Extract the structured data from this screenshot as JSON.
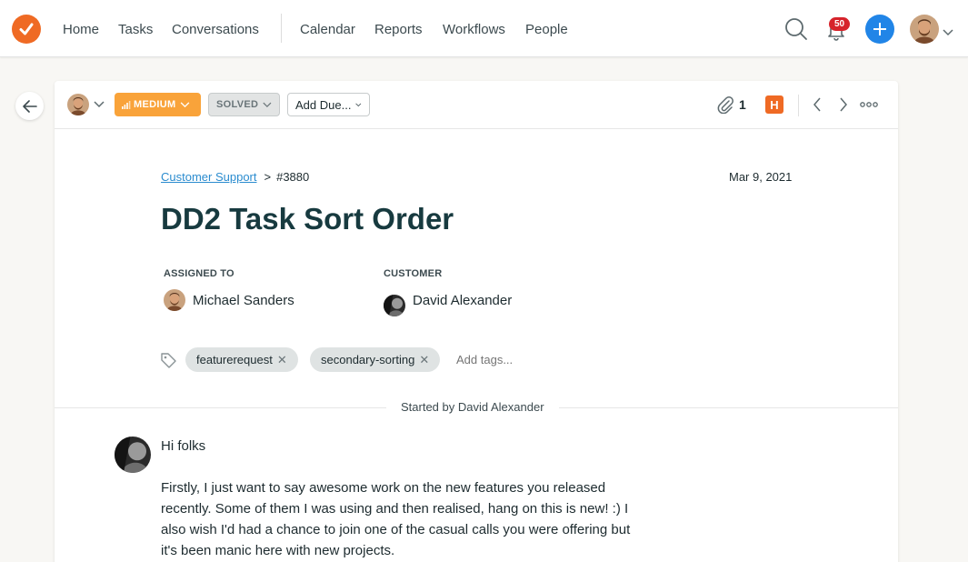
{
  "nav": {
    "links": [
      "Home",
      "Tasks",
      "Conversations",
      "Calendar",
      "Reports",
      "Workflows",
      "People"
    ],
    "notification_count": "50"
  },
  "toolbar": {
    "priority": "MEDIUM",
    "status": "SOLVED",
    "due": "Add Due...",
    "attachment_count": "1",
    "integration_badge": "H"
  },
  "ticket": {
    "breadcrumb_parent": "Customer Support",
    "breadcrumb_sep": ">",
    "number": "#3880",
    "date": "Mar 9, 2021",
    "title": "DD2 Task Sort Order",
    "assigned_label": "ASSIGNED TO",
    "assigned_name": "Michael Sanders",
    "customer_label": "CUSTOMER",
    "customer_name": "David Alexander",
    "tags": [
      "featurerequest",
      "secondary-sorting"
    ],
    "tag_placeholder": "Add tags...",
    "started_by": "Started by David Alexander"
  },
  "message": {
    "greeting": "Hi folks",
    "body": "Firstly, I just want to say awesome work on the new features you released recently. Some of them I was using and then realised, hang on this is new! :) I also wish I'd had a chance to join one of the casual calls you were offering but it's been manic here with new projects."
  },
  "colors": {
    "brand_orange": "#ef6a24",
    "priority_medium": "#f9a33a",
    "primary_blue": "#2185e7",
    "link_blue": "#2b8ccf",
    "badge_red": "#d6232b"
  },
  "icons": [
    "logo-check-icon",
    "search-icon",
    "bell-icon",
    "plus-icon",
    "chevron-down-icon",
    "back-arrow-icon",
    "signal-bars-icon",
    "paperclip-icon",
    "chevron-left-icon",
    "chevron-right-icon",
    "more-dots-icon",
    "tag-icon",
    "close-icon"
  ]
}
